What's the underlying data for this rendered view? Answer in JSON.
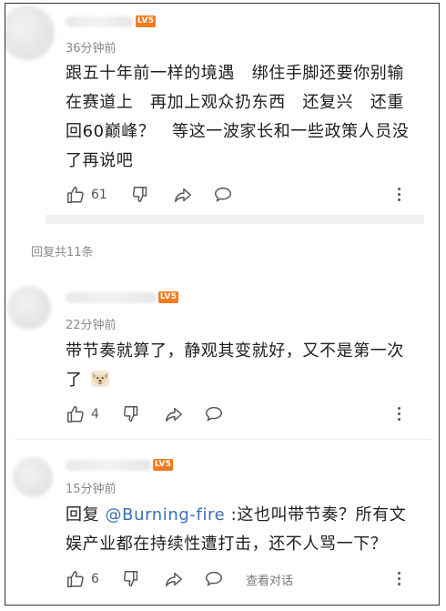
{
  "comments": [
    {
      "badge": "LV5",
      "time": "36分钟前",
      "text": "跟五十年前一样的境遇　绑住手脚还要你别输在赛道上　再加上观众扔东西　还复兴　还重回60巅峰？　等这一波家长和一些政策人员没了再说吧",
      "likes": "61"
    }
  ],
  "reply_section": {
    "total_label": "回复共11条"
  },
  "replies": [
    {
      "badge": "LV5",
      "time": "22分钟前",
      "text": "带节奏就算了，静观其变就好，又不是第一次了",
      "likes": "4",
      "emoji": "dog-face-emoji"
    },
    {
      "badge": "LV5",
      "time": "15分钟前",
      "prefix": "回复 ",
      "mention": "@Burning-fire",
      "text": " :这也叫带节奏？所有文娱产业都在持续性遭打击，还不人骂一下？",
      "likes": "6",
      "view_conversation": "查看对话"
    }
  ],
  "colors": {
    "badge": "#f47a1f",
    "mention": "#3a6fb5",
    "time": "#8a8a8a"
  }
}
